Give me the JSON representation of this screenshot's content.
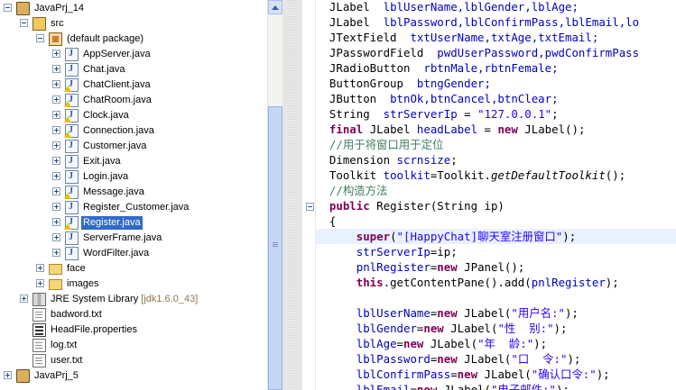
{
  "explorer": {
    "items": [
      {
        "label": "JavaPrj_14",
        "deco": "",
        "indent": 0,
        "twisty": "minus",
        "icon": "project",
        "selected": false,
        "name": "project-javaprj14"
      },
      {
        "label": "src",
        "deco": "",
        "indent": 1,
        "twisty": "minus",
        "icon": "src",
        "selected": false,
        "name": "folder-src"
      },
      {
        "label": "(default package)",
        "deco": "",
        "indent": 2,
        "twisty": "minus",
        "icon": "package",
        "selected": false,
        "name": "package-default"
      },
      {
        "label": "AppServer.java",
        "deco": "",
        "indent": 3,
        "twisty": "plus",
        "icon": "java",
        "selected": false,
        "name": "file-appserver"
      },
      {
        "label": "Chat.java",
        "deco": "",
        "indent": 3,
        "twisty": "plus",
        "icon": "java",
        "selected": false,
        "name": "file-chat"
      },
      {
        "label": "ChatClient.java",
        "deco": "",
        "indent": 3,
        "twisty": "plus",
        "icon": "java-warn",
        "selected": false,
        "name": "file-chatclient"
      },
      {
        "label": "ChatRoom.java",
        "deco": "",
        "indent": 3,
        "twisty": "plus",
        "icon": "java-warn",
        "selected": false,
        "name": "file-chatroom"
      },
      {
        "label": "Clock.java",
        "deco": "",
        "indent": 3,
        "twisty": "plus",
        "icon": "java-warn",
        "selected": false,
        "name": "file-clock"
      },
      {
        "label": "Connection.java",
        "deco": "",
        "indent": 3,
        "twisty": "plus",
        "icon": "java-warn",
        "selected": false,
        "name": "file-connection"
      },
      {
        "label": "Customer.java",
        "deco": "",
        "indent": 3,
        "twisty": "plus",
        "icon": "java",
        "selected": false,
        "name": "file-customer"
      },
      {
        "label": "Exit.java",
        "deco": "",
        "indent": 3,
        "twisty": "plus",
        "icon": "java",
        "selected": false,
        "name": "file-exit"
      },
      {
        "label": "Login.java",
        "deco": "",
        "indent": 3,
        "twisty": "plus",
        "icon": "java",
        "selected": false,
        "name": "file-login"
      },
      {
        "label": "Message.java",
        "deco": "",
        "indent": 3,
        "twisty": "plus",
        "icon": "java-warn",
        "selected": false,
        "name": "file-message"
      },
      {
        "label": "Register_Customer.java",
        "deco": "",
        "indent": 3,
        "twisty": "plus",
        "icon": "java",
        "selected": false,
        "name": "file-register-customer"
      },
      {
        "label": "Register.java",
        "deco": "",
        "indent": 3,
        "twisty": "plus",
        "icon": "java-warn",
        "selected": true,
        "name": "file-register"
      },
      {
        "label": "ServerFrame.java",
        "deco": "",
        "indent": 3,
        "twisty": "plus",
        "icon": "java",
        "selected": false,
        "name": "file-serverframe"
      },
      {
        "label": "WordFilter.java",
        "deco": "",
        "indent": 3,
        "twisty": "plus",
        "icon": "java",
        "selected": false,
        "name": "file-wordfilter"
      },
      {
        "label": "face",
        "deco": "",
        "indent": 2,
        "twisty": "plus",
        "icon": "folder",
        "selected": false,
        "name": "folder-face"
      },
      {
        "label": "images",
        "deco": "",
        "indent": 2,
        "twisty": "plus",
        "icon": "folder",
        "selected": false,
        "name": "folder-images"
      },
      {
        "label": "JRE System Library",
        "deco": "[jdk1.6.0_43]",
        "indent": 1,
        "twisty": "plus",
        "icon": "library",
        "selected": false,
        "name": "jre-system-library"
      },
      {
        "label": "badword.txt",
        "deco": "",
        "indent": 1,
        "twisty": "",
        "icon": "file",
        "selected": false,
        "name": "file-badword-txt"
      },
      {
        "label": "HeadFile.properties",
        "deco": "",
        "indent": 1,
        "twisty": "",
        "icon": "props",
        "selected": false,
        "name": "file-headfile-properties"
      },
      {
        "label": "log.txt",
        "deco": "",
        "indent": 1,
        "twisty": "",
        "icon": "file",
        "selected": false,
        "name": "file-log-txt"
      },
      {
        "label": "user.txt",
        "deco": "",
        "indent": 1,
        "twisty": "",
        "icon": "file",
        "selected": false,
        "name": "file-user-txt"
      },
      {
        "label": "JavaPrj_5",
        "deco": "",
        "indent": 0,
        "twisty": "plus",
        "icon": "project",
        "selected": false,
        "name": "project-javaprj5"
      }
    ]
  },
  "editor": {
    "current_line": 15,
    "lines": [
      [
        [
          "  JLabel  ",
          ""
        ],
        [
          "lblUserName,lblGender,lblAge;",
          "fld"
        ]
      ],
      [
        [
          "  JLabel  ",
          ""
        ],
        [
          "lblPassword,lblConfirmPass,lblEmail,lo",
          "fld"
        ]
      ],
      [
        [
          "  JTextField  ",
          ""
        ],
        [
          "txtUserName,txtAge,txtEmail;",
          "fld"
        ]
      ],
      [
        [
          "  JPasswordField  ",
          ""
        ],
        [
          "pwdUserPassword,pwdConfirmPass",
          "fld"
        ]
      ],
      [
        [
          "  JRadioButton  ",
          ""
        ],
        [
          "rbtnMale,rbtnFemale;",
          "fld"
        ]
      ],
      [
        [
          "  ButtonGroup  ",
          ""
        ],
        [
          "btngGender;",
          "fld"
        ]
      ],
      [
        [
          "  JButton  ",
          ""
        ],
        [
          "btnOk,btnCancel,btnClear;",
          "fld"
        ]
      ],
      [
        [
          "  String  ",
          ""
        ],
        [
          "strServerIp",
          "fld"
        ],
        [
          " = ",
          ""
        ],
        [
          "\"127.0.0.1\"",
          "str"
        ],
        [
          ";",
          ""
        ]
      ],
      [
        [
          "  ",
          ""
        ],
        [
          "final",
          "kw"
        ],
        [
          " JLabel ",
          ""
        ],
        [
          "headLabel",
          "fld"
        ],
        [
          " = ",
          ""
        ],
        [
          "new",
          "kw"
        ],
        [
          " JLabel();",
          ""
        ]
      ],
      [
        [
          "  //用于将窗口用于定位",
          "cmt"
        ]
      ],
      [
        [
          "  Dimension ",
          ""
        ],
        [
          "scrnsize",
          "fld"
        ],
        [
          ";",
          ""
        ]
      ],
      [
        [
          "  Toolkit ",
          ""
        ],
        [
          "toolkit",
          "fld"
        ],
        [
          "=Toolkit.",
          ""
        ],
        [
          "getDefaultToolkit",
          "itl"
        ],
        [
          "();",
          ""
        ]
      ],
      [
        [
          "  //构造方法",
          "cmt"
        ]
      ],
      [
        [
          "  ",
          ""
        ],
        [
          "public",
          "kw"
        ],
        [
          " Register(String ip)",
          ""
        ]
      ],
      [
        [
          "  {",
          ""
        ]
      ],
      [
        [
          "      ",
          ""
        ],
        [
          "super",
          "kw"
        ],
        [
          "(",
          ""
        ],
        [
          "\"[HappyChat]聊天室注册窗口\"",
          "str"
        ],
        [
          ");",
          ""
        ]
      ],
      [
        [
          "      ",
          ""
        ],
        [
          "strServerIp",
          "fld"
        ],
        [
          "=ip;",
          ""
        ]
      ],
      [
        [
          "      ",
          ""
        ],
        [
          "pnlRegister",
          "fld"
        ],
        [
          "=",
          ""
        ],
        [
          "new",
          "kw"
        ],
        [
          " JPanel();",
          ""
        ]
      ],
      [
        [
          "      ",
          ""
        ],
        [
          "this",
          "kw"
        ],
        [
          ".getContentPane().add(",
          ""
        ],
        [
          "pnlRegister",
          "fld"
        ],
        [
          ");",
          ""
        ]
      ],
      [
        [
          "",
          ""
        ]
      ],
      [
        [
          "      ",
          ""
        ],
        [
          "lblUserName",
          "fld"
        ],
        [
          "=",
          ""
        ],
        [
          "new",
          "kw"
        ],
        [
          " JLabel(",
          ""
        ],
        [
          "\"用户名:\"",
          "str"
        ],
        [
          ");",
          ""
        ]
      ],
      [
        [
          "      ",
          ""
        ],
        [
          "lblGender",
          "fld"
        ],
        [
          "=",
          ""
        ],
        [
          "new",
          "kw"
        ],
        [
          " JLabel(",
          ""
        ],
        [
          "\"性  别:\"",
          "str"
        ],
        [
          ");",
          ""
        ]
      ],
      [
        [
          "      ",
          ""
        ],
        [
          "lblAge",
          "fld"
        ],
        [
          "=",
          ""
        ],
        [
          "new",
          "kw"
        ],
        [
          " JLabel(",
          ""
        ],
        [
          "\"年  龄:\"",
          "str"
        ],
        [
          ");",
          ""
        ]
      ],
      [
        [
          "      ",
          ""
        ],
        [
          "lblPassword",
          "fld"
        ],
        [
          "=",
          ""
        ],
        [
          "new",
          "kw"
        ],
        [
          " JLabel(",
          ""
        ],
        [
          "\"口  令:\"",
          "str"
        ],
        [
          ");",
          ""
        ]
      ],
      [
        [
          "      ",
          ""
        ],
        [
          "lblConfirmPass",
          "fld"
        ],
        [
          "=",
          ""
        ],
        [
          "new",
          "kw"
        ],
        [
          " JLabel(",
          ""
        ],
        [
          "\"确认口令:\"",
          "str"
        ],
        [
          ");",
          ""
        ]
      ],
      [
        [
          "      ",
          ""
        ],
        [
          "lblEmail",
          "fld"
        ],
        [
          "=",
          ""
        ],
        [
          "new",
          "kw"
        ],
        [
          " JLabel(",
          ""
        ],
        [
          "\"电子邮件:\"",
          "str"
        ],
        [
          ");",
          ""
        ]
      ]
    ]
  }
}
